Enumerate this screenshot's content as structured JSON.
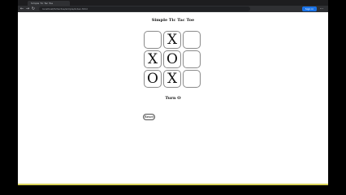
{
  "browser": {
    "tab_title": "Simple Tic Tac Toe",
    "url": "localhost/tictactoe/simple/index.html",
    "button_label": "Sign in"
  },
  "game": {
    "title": "Simple Tic Tac Toe",
    "cells": [
      "",
      "X",
      "",
      "X",
      "O",
      "",
      "O",
      "X",
      ""
    ],
    "status": "Turn O",
    "reset_label": "Reset"
  }
}
